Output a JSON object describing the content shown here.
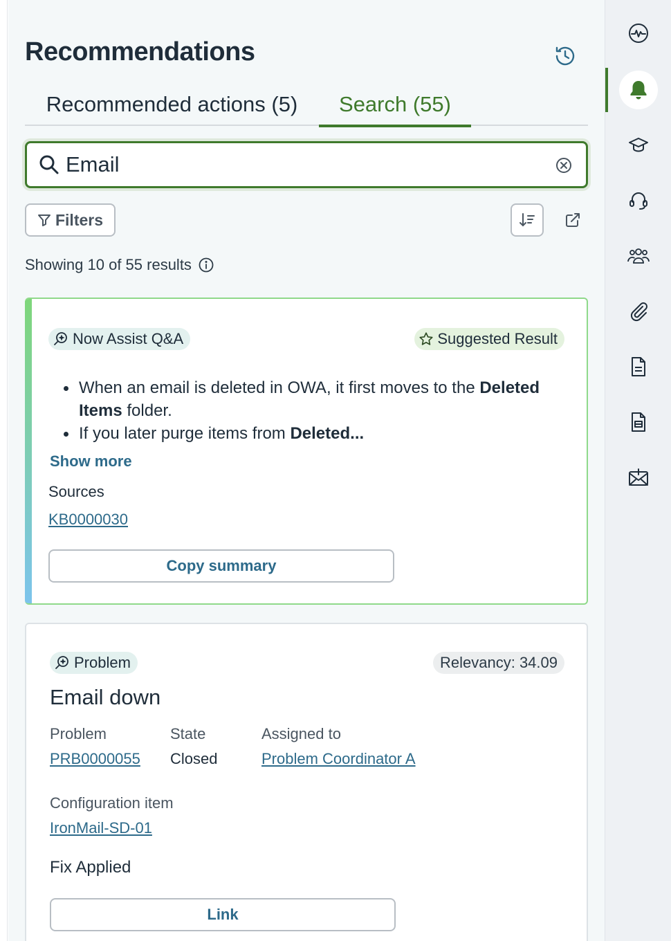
{
  "header": {
    "title": "Recommendations"
  },
  "tabs": [
    {
      "label": "Recommended actions (5)",
      "active": false
    },
    {
      "label": "Search (55)",
      "active": true
    }
  ],
  "search": {
    "value": "Email",
    "placeholder": ""
  },
  "toolbar": {
    "filters_label": "Filters"
  },
  "results": {
    "count_text": "Showing 10 of 55 results"
  },
  "qa_card": {
    "badge": "Now Assist Q&A",
    "suggested_label": "Suggested Result",
    "bullet1_pre": "When an email is deleted in OWA, it first moves to the ",
    "bullet1_bold": "Deleted Items",
    "bullet1_post": " folder.",
    "bullet2_pre": "If you later purge items from ",
    "bullet2_bold": "Deleted...",
    "show_more": "Show more",
    "sources_label": "Sources",
    "source_link": "KB0000030",
    "copy_button": "Copy summary"
  },
  "problem_card": {
    "badge": "Problem",
    "relevancy": "Relevancy: 34.09",
    "title": "Email down",
    "fields": {
      "problem_label": "Problem",
      "problem_value": "PRB0000055",
      "state_label": "State",
      "state_value": "Closed",
      "assigned_label": "Assigned to",
      "assigned_value": "Problem Coordinator A",
      "ci_label": "Configuration item",
      "ci_value": "IronMail-SD-01"
    },
    "fix_applied": "Fix Applied",
    "link_button": "Link"
  },
  "rail": {
    "icons": [
      "pulse-icon",
      "bell-icon",
      "graduation-cap-icon",
      "headset-icon",
      "group-icon",
      "paperclip-icon",
      "document-icon",
      "list-document-icon",
      "email-add-icon"
    ],
    "active": "bell-icon"
  },
  "colors": {
    "accent_green": "#3f7a2c",
    "link_blue": "#2d6a8a",
    "text": "#1f2d3a"
  }
}
